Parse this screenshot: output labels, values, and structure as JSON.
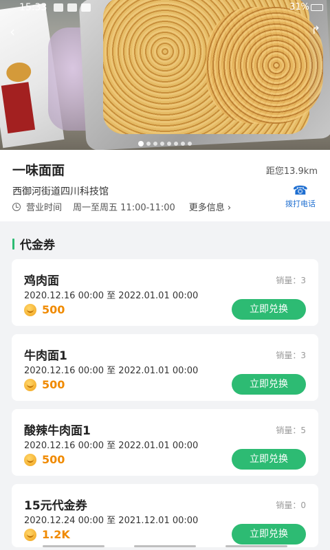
{
  "status_bar": {
    "time": "15:33",
    "right_text": "31%"
  },
  "hero": {
    "image": "noodles-photo",
    "back_icon": "back-arrow-icon",
    "share_icon": "share-icon",
    "carousel_total": 8,
    "carousel_active": 1
  },
  "store": {
    "name": "一味面面",
    "distance": "距您13.9km",
    "address": "西御河街道四川科技馆",
    "hours_label": "营业时间",
    "hours_value": "周一至周五 11:00-11:00",
    "more_info": "更多信息",
    "call_label": "拨打电话"
  },
  "section": {
    "title": "代金券"
  },
  "vouchers": [
    {
      "name": "鸡肉面",
      "sales": "销量：3",
      "period": "2020.12.16 00:00 至 2022.01.01 00:00",
      "price": "500",
      "button": "立即兑换"
    },
    {
      "name": "牛肉面1",
      "sales": "销量：3",
      "period": "2020.12.16 00:00 至 2022.01.01 00:00",
      "price": "500",
      "button": "立即兑换"
    },
    {
      "name": "酸辣牛肉面1",
      "sales": "销量：5",
      "period": "2020.12.16 00:00 至 2022.01.01 00:00",
      "price": "500",
      "button": "立即兑换"
    },
    {
      "name": "15元代金券",
      "sales": "销量：0",
      "period": "2020.12.24 00:00 至 2021.12.01 00:00",
      "price": "1.2K",
      "button": "立即兑换"
    }
  ],
  "colors": {
    "accent": "#2dbb73",
    "price": "#f08a00",
    "call": "#1f6fd1"
  }
}
